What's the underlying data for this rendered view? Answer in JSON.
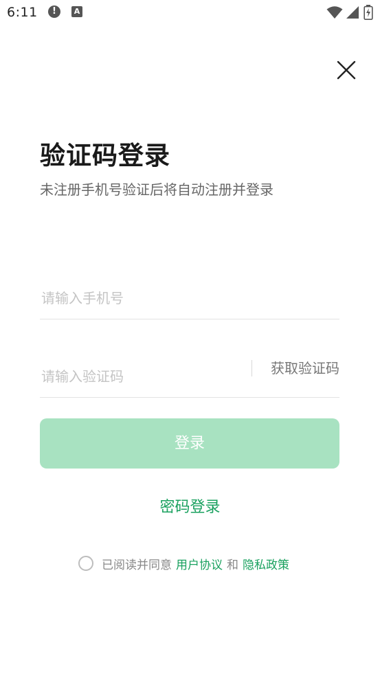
{
  "status_bar": {
    "time": "6:11",
    "alert_icon_glyph": "!",
    "keyboard_icon_glyph": "A"
  },
  "header": {
    "title": "验证码登录",
    "subtitle": "未注册手机号验证后将自动注册并登录"
  },
  "form": {
    "phone_placeholder": "请输入手机号",
    "phone_value": "",
    "code_placeholder": "请输入验证码",
    "code_value": "",
    "get_code_label": "获取验证码",
    "login_label": "登录"
  },
  "password_login_label": "密码登录",
  "agreement": {
    "prefix": "已阅读并同意",
    "user_agreement": "用户协议",
    "conjunction": "和",
    "privacy_policy": "隐私政策",
    "checked": false
  },
  "colors": {
    "accent": "#1aa15f",
    "button_disabled": "#a8e2c1"
  }
}
